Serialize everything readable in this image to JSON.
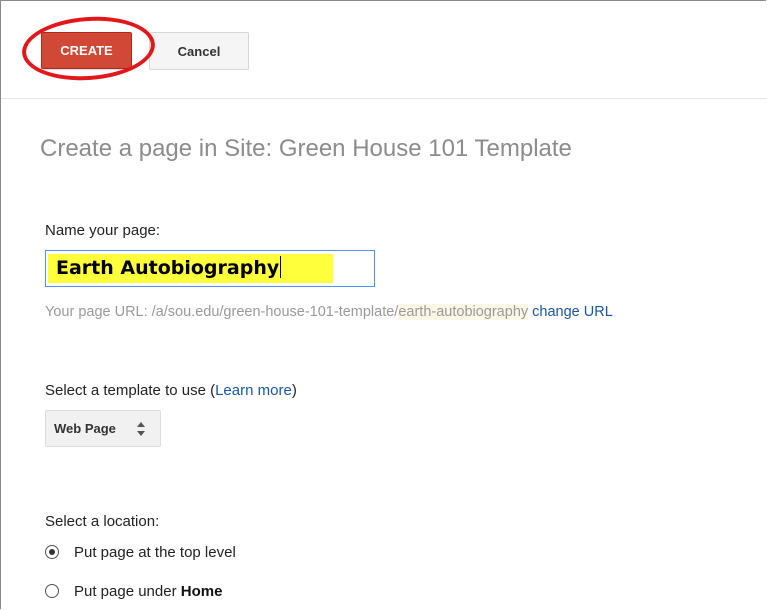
{
  "toolbar": {
    "create_label": "CREATE",
    "cancel_label": "Cancel"
  },
  "page_title": "Create a page in Site: Green House 101 Template",
  "name_section": {
    "label": "Name your page:",
    "value": "Earth Autobiography"
  },
  "url_section": {
    "prefix": "Your page URL: /a/sou.edu/green-house-101-template/",
    "slug": "earth-autobiography",
    "change_link": "change URL"
  },
  "template_section": {
    "label_prefix": "Select a template to use (",
    "learn_more": "Learn more",
    "label_suffix": ")",
    "selected": "Web Page"
  },
  "location_section": {
    "label": "Select a location:",
    "options": [
      {
        "text": "Put page at the top level",
        "checked": true
      },
      {
        "text_prefix": "Put page under ",
        "text_bold": "Home",
        "checked": false
      }
    ]
  },
  "colors": {
    "create_button": "#d14836",
    "highlight": "#ffff3b",
    "annotation_oval": "#e3161c",
    "link": "#1a57a8"
  },
  "icons": {
    "select_arrows": "up-down-arrows-icon"
  }
}
